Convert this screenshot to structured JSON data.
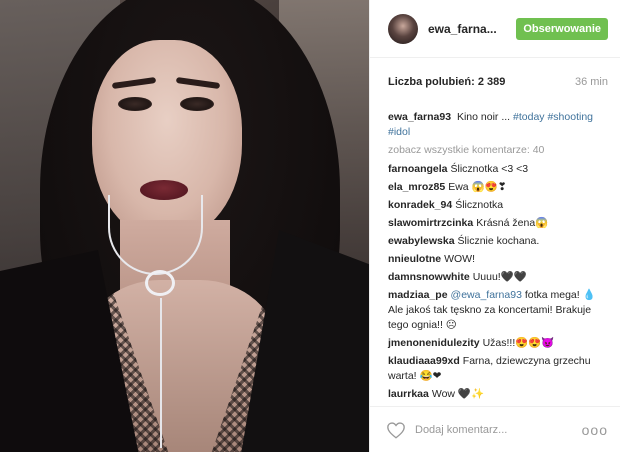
{
  "post": {
    "username": "ewa_farna...",
    "follow_label": "Obserwowanie",
    "likes": "Liczba polubień: 2 389",
    "time_ago": "36 min",
    "caption": {
      "user": "ewa_farna93",
      "text": "Kino noir ...",
      "tags": [
        "#today",
        "#shooting",
        "#idol"
      ]
    },
    "view_all": "zobacz wszystkie komentarze: 40",
    "comments": [
      {
        "user": "farnoangela",
        "text": "Ślicznotka <3 <3"
      },
      {
        "user": "ela_mroz85",
        "text": "Ewa 😱😍❣"
      },
      {
        "user": "konradek_94",
        "text": "Ślicznotka"
      },
      {
        "user": "slawomirtrzcinka",
        "text": "Krásná žena😱"
      },
      {
        "user": "ewabylewska",
        "text": "Ślicznie kochana."
      },
      {
        "user": "nnieulotne",
        "text": "WOW!"
      },
      {
        "user": "damnsnowwhite",
        "text": "Uuuu!🖤🖤"
      },
      {
        "user": "madziaa_pe",
        "mention": "@ewa_farna93",
        "text": "fotka mega! 💧Ale jakoś tak tęskno za koncertami! Brakuje tego ognia!! ☹"
      },
      {
        "user": "jmenonenidulezity",
        "text": "Užas!!!😍😍😈"
      },
      {
        "user": "klaudiaaa99xd",
        "text": "Farna, dziewczyna grzechu warta! 😂❤"
      },
      {
        "user": "laurrkaa",
        "text": "Wow 🖤✨"
      }
    ],
    "add_comment_placeholder": "Dodaj komentarz...",
    "more_glyph": "ooo"
  },
  "colors": {
    "follow_green": "#70c050",
    "tag_blue": "#3f729b",
    "muted": "#999999"
  },
  "icons": {
    "like": "heart-icon",
    "options": "more-options-icon"
  }
}
